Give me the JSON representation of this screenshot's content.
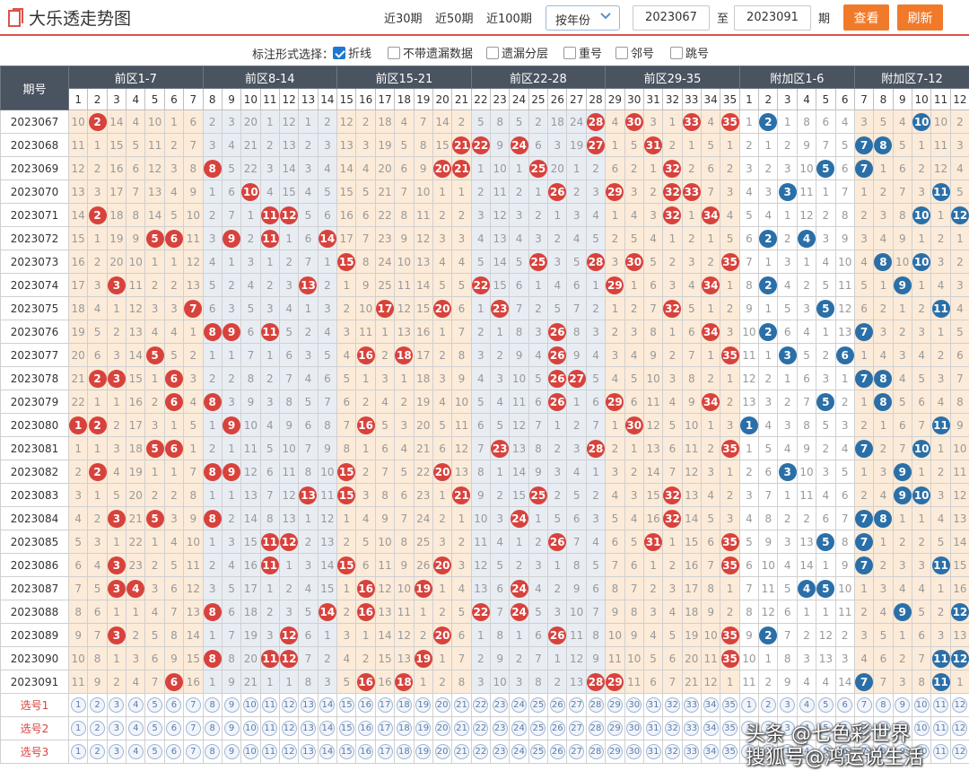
{
  "header": {
    "title": "大乐透走势图",
    "periods": [
      "近30期",
      "近50期",
      "近100期"
    ],
    "select_value": "按年份",
    "from": "2023067",
    "to_label": "至",
    "to": "2023091",
    "unit": "期",
    "btn_query": "查看",
    "btn_refresh": "刷新"
  },
  "options": {
    "title": "标注形式选择：",
    "items": [
      {
        "label": "折线",
        "checked": true
      },
      {
        "label": "不带遗漏数据",
        "checked": false
      },
      {
        "label": "遗漏分层",
        "checked": false
      },
      {
        "label": "重号",
        "checked": false
      },
      {
        "label": "邻号",
        "checked": false
      },
      {
        "label": "跳号",
        "checked": false
      }
    ]
  },
  "table": {
    "issue_header": "期号",
    "zones": [
      {
        "label": "前区1-7",
        "start": 1,
        "end": 7
      },
      {
        "label": "前区8-14",
        "start": 8,
        "end": 14
      },
      {
        "label": "前区15-21",
        "start": 15,
        "end": 21
      },
      {
        "label": "前区22-28",
        "start": 22,
        "end": 28
      },
      {
        "label": "前区29-35",
        "start": 29,
        "end": 35
      },
      {
        "label": "附加区1-6",
        "start": 1,
        "end": 6
      },
      {
        "label": "附加区7-12",
        "start": 7,
        "end": 12
      }
    ],
    "rows": [
      {
        "issue": "2023067",
        "front": "10|2*|14|4|10|1|6|2|3|20|1|12|1|2|12|2|18|4|7|14|2|5|8|5|2|18|24|28*|4|30*|3|1|33*|4|35*",
        "back": "1|2*|1|8|6|4|3|5|4|10*|10|2"
      },
      {
        "issue": "2023068",
        "front": "11|1|15|5|11|2|7|3|4|21|2|13|2|3|13|3|19|5|8|15|21*|22*|9|24*|6|3|19|27*|1|5|31*|2|1|5|1",
        "back": "2|1|2|9|7|5|7*|8*|5|1|11|3"
      },
      {
        "issue": "2023069",
        "front": "12|2|16|6|12|3|8|8*|5|22|3|14|3|4|14|4|20|6|9|20*|21*|1|10|1|25*|20|1|2|6|2|1|32*|2|6|2",
        "back": "3|2|3|10|5*|6|7*|1|6|2|12|4"
      },
      {
        "issue": "2023070",
        "front": "13|3|17|7|13|4|9|1|6|10*|4|15|4|5|15|5|21|7|10|1|1|2|11|2|1|26*|2|3|29*|3|2|32*|33*|7|3",
        "back": "4|3|3*|11|1|7|1|2|7|3|11*|5"
      },
      {
        "issue": "2023071",
        "front": "14|2*|18|8|14|5|10|2|7|1|11*|12*|5|6|16|6|22|8|11|2|2|3|12|3|2|1|3|4|1|4|3|32*|1|34*|4",
        "back": "5|4|1|12|2|8|2|3|8|10*|1|12*"
      },
      {
        "issue": "2023072",
        "front": "15|1|19|9|5*|6*|11|3|9*|2|11*|1|6|14*|17|7|23|9|12|3|3|4|13|4|3|2|4|5|2|5|4|1|2|1|5",
        "back": "6|2*|2|4*|3|9|3|4|9|1|2|1"
      },
      {
        "issue": "2023073",
        "front": "16|2|20|10|1|1|12|4|1|3|1|2|7|1|15*|8|24|10|13|4|4|5|14|5|25*|3|5|28*|3|30*|5|2|3|2|35*",
        "back": "7|1|3|1|4|10|4|8*|10|10*|3|2"
      },
      {
        "issue": "2023074",
        "front": "17|3|3*|11|2|2|13|5|2|4|2|3|13*|2|1|9|25|11|14|5|5|22*|15|6|1|4|6|1|29*|1|6|3|4|34*|1",
        "back": "8|2*|4|2|5|11|5|1|9*|1|4|3"
      },
      {
        "issue": "2023075",
        "front": "18|4|1|12|3|3|7*|6|3|5|3|4|1|3|2|10|17*|12|15|20*|6|1|23*|7|2|5|7|2|1|2|7|32*|5|1|2",
        "back": "9|1|5|3|5*|12|6|2|1|2|11*|4"
      },
      {
        "issue": "2023076",
        "front": "19|5|2|13|4|4|1|8*|9*|6|11*|5|2|4|3|11|1|13|16|1|7|2|1|8|3|26*|8|3|2|3|8|1|6|34*|3",
        "back": "10|2*|6|4|1|13|7*|3|2|3|1|5"
      },
      {
        "issue": "2023077",
        "front": "20|6|3|14|5*|5|2|1|1|7|1|6|3|5|4|16*|2|18*|17|2|8|3|2|9|4|26*|9|4|3|4|9|2|7|1|35*",
        "back": "11|1|3*|5|2|6*|1|4|3|4|2|6"
      },
      {
        "issue": "2023078",
        "front": "21|2*|3*|15|1|6*|3|2|2|8|2|7|4|6|5|1|3|1|18|3|9|4|3|10|5|26*|27*|5|4|5|10|3|8|2|1",
        "back": "12|2|1|6|3|1|7*|8*|4|5|3|7"
      },
      {
        "issue": "2023079",
        "front": "22|1|1|16|2|6*|4|8*|3|9|3|8|5|7|6|2|4|2|19|4|10|5|4|11|6|26*|1|6|29*|6|11|4|9|34*|2",
        "back": "13|3|2|7|5*|2|1|8*|5|6|4|8"
      },
      {
        "issue": "2023080",
        "front": "1*|2*|2|17|3|1|5|1|9*|10|4|9|6|8|7|16*|5|3|20|5|11|6|5|12|7|1|2|7|1|30*|12|5|10|1|3",
        "back": "1*|4|3|8|5|3|2|1|6|7|11*|9"
      },
      {
        "issue": "2023081",
        "front": "1|1|3|18|5*|6*|1|2|1|11|5|10|7|9|8|1|6|4|21|6|12|7|23*|13|8|2|3|28*|2|1|13|6|11|2|35*",
        "back": "1|5|4|9|2|4|7*|2|7|10*|1|10"
      },
      {
        "issue": "2023082",
        "front": "2|2*|4|19|1|1|7|8*|9*|12|6|11|8|10|15*|2|7|5|22|20*|13|8|1|14|9|3|4|1|3|2|14|7|12|3|1",
        "back": "2|6|3*|10|3|5|1|3|9*|1|2|11"
      },
      {
        "issue": "2023083",
        "front": "3|1|5|20|2|2|8|1|1|13|7|12|13*|11|15*|3|8|6|23|1|21*|9|2|15|25*|2|5|2|4|3|15|32*|13|4|2",
        "back": "3|7|1|11|4|6|2|4|9*|10*|3|12"
      },
      {
        "issue": "2023084",
        "front": "4|2|3*|21|5*|3|9|8*|2|14|8|13|1|12|1|4|9|7|24|2|1|10|3|24*|1|5|6|3|5|4|16|32*|14|5|3",
        "back": "4|8|2|2|6|7|7*|8*|1|1|4|13"
      },
      {
        "issue": "2023085",
        "front": "5|3|1|22|1|4|10|1|3|15|11*|12*|2|13|2|5|10|8|25|3|2|11|4|1|2|26*|7|4|6|5|31*|1|15|6|35*",
        "back": "5|9|3|13|5*|8|7*|1|2|2|5|14"
      },
      {
        "issue": "2023086",
        "front": "6|4|3*|23|2|5|11|2|4|16|11*|1|3|14|15*|6|11|9|26|20*|3|12|5|2|3|1|8|5|7|6|1|2|16|7|35*",
        "back": "6|10|4|14|1|9|7*|2|3|3|11*|15"
      },
      {
        "issue": "2023087",
        "front": "7|5|3*|4*|3|6|12|3|5|17|1|2|4|15|1|16*|12|10|19*|1|4|13|6|24*|4|2|9|6|8|7|2|3|17|8|1",
        "back": "7|11|5|4*|5*|10|1|3|4|4|1|16"
      },
      {
        "issue": "2023088",
        "front": "8|6|1|1|4|7|13|8*|6|18|2|3|5|14*|2|16*|13|11|1|2|5|22*|7|24*|5|3|10|7|9|8|3|4|18|9|2",
        "back": "8|12|6|1|1|11|2|4|9*|5|2|12*"
      },
      {
        "issue": "2023089",
        "front": "9|7|3*|2|5|8|14|1|7|19|3|12*|6|1|3|1|14|12|2|20*|6|1|8|1|6|26*|11|8|10|9|4|5|19|10|35*",
        "back": "9|2*|7|2|12|2|3|5|1|6|3|13"
      },
      {
        "issue": "2023090",
        "front": "10|8|1|3|6|9|15|8*|8|20|11*|12*|7|2|4|2|15|13|19*|1|7|2|9|2|7|1|12|9|11|10|5|6|20|11|35*",
        "back": "10|1|8|3|13|3|4|6|2|7|11*|12*"
      },
      {
        "issue": "2023091",
        "front": "11|9|2|4|7|6*|16|1|9|21|1|1|8|3|5|16*|16|18*|1|2|8|3|10|3|8|2|13|28*|29*|11|6|7|21|12|1",
        "back": "11|2|9|4|4|14|7*|7|3|8|11*|1"
      }
    ],
    "pick_rows": [
      "选号1",
      "选号2",
      "选号3"
    ]
  },
  "watermark": {
    "line1": "头条 @七色彩世界",
    "line2": "搜狐号@鸿运说生活"
  }
}
